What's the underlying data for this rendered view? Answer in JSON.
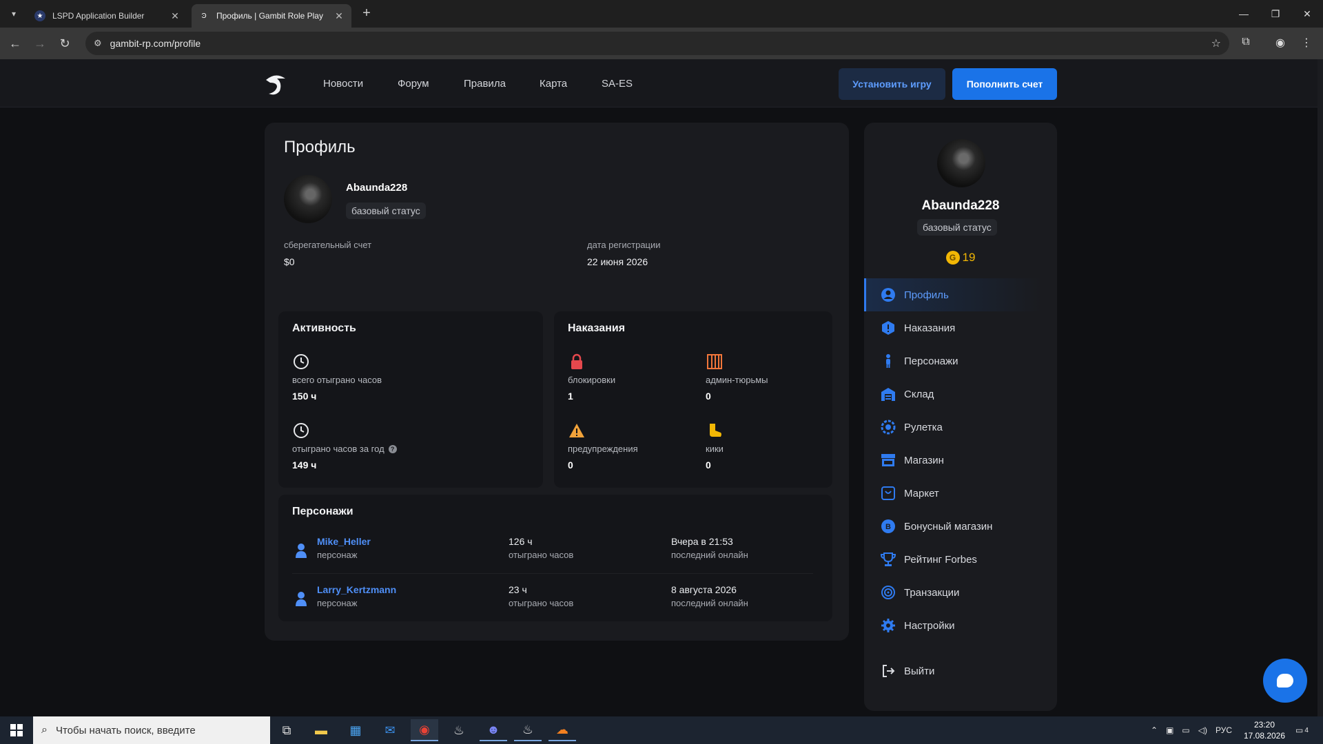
{
  "browser": {
    "tabs": [
      {
        "title": "LSPD Application Builder",
        "active": false
      },
      {
        "title": "Профиль | Gambit Role Play",
        "active": true
      }
    ],
    "url": "gambit-rp.com/profile"
  },
  "header": {
    "nav": [
      "Новости",
      "Форум",
      "Правила",
      "Карта",
      "SA-ES"
    ],
    "install_label": "Установить игру",
    "topup_label": "Пополнить счет"
  },
  "profile": {
    "title": "Профиль",
    "username": "Abaunda228",
    "status": "базовый статус",
    "savings_label": "сберегательный счет",
    "savings_value": "$0",
    "reg_label": "дата регистрации",
    "reg_value": "22 июня 2026"
  },
  "activity": {
    "title": "Активность",
    "total_label": "всего отыграно часов",
    "total_value": "150 ч",
    "year_label": "отыграно часов за год",
    "year_value": "149 ч"
  },
  "punishments": {
    "title": "Наказания",
    "bans_label": "блокировки",
    "bans_value": "1",
    "jail_label": "админ-тюрьмы",
    "jail_value": "0",
    "warn_label": "предупреждения",
    "warn_value": "0",
    "kick_label": "кики",
    "kick_value": "0"
  },
  "characters": {
    "title": "Персонажи",
    "rows": [
      {
        "name": "Mike_Heller",
        "role": "персонаж",
        "hours": "126 ч",
        "hours_label": "отыграно часов",
        "last": "Вчера в 21:53",
        "last_label": "последний онлайн"
      },
      {
        "name": "Larry_Kertzmann",
        "role": "персонаж",
        "hours": "23 ч",
        "hours_label": "отыграно часов",
        "last": "8 августа 2026",
        "last_label": "последний онлайн"
      }
    ]
  },
  "sidebar": {
    "username": "Abaunda228",
    "status": "базовый статус",
    "coins": "19",
    "items": [
      {
        "label": "Профиль",
        "icon": "user-circle-icon",
        "active": true
      },
      {
        "label": "Наказания",
        "icon": "alert-icon"
      },
      {
        "label": "Персонажи",
        "icon": "person-icon"
      },
      {
        "label": "Склад",
        "icon": "warehouse-icon"
      },
      {
        "label": "Рулетка",
        "icon": "roulette-icon"
      },
      {
        "label": "Магазин",
        "icon": "shop-icon"
      },
      {
        "label": "Маркет",
        "icon": "market-bag-icon"
      },
      {
        "label": "Бонусный магазин",
        "icon": "bonus-icon"
      },
      {
        "label": "Рейтинг Forbes",
        "icon": "trophy-icon"
      },
      {
        "label": "Транзакции",
        "icon": "transactions-icon"
      },
      {
        "label": "Настройки",
        "icon": "gear-icon"
      }
    ],
    "logout": "Выйти"
  },
  "taskbar": {
    "search_placeholder": "Чтобы начать поиск, введите",
    "lang": "РУС",
    "time": "23:20",
    "date": "17.08.2026",
    "notifications": "4"
  },
  "colors": {
    "accent": "#1a73e8",
    "link": "#4f8ff7",
    "danger": "#e5484d",
    "warning": "#f2a33a",
    "coin": "#f2b705"
  }
}
